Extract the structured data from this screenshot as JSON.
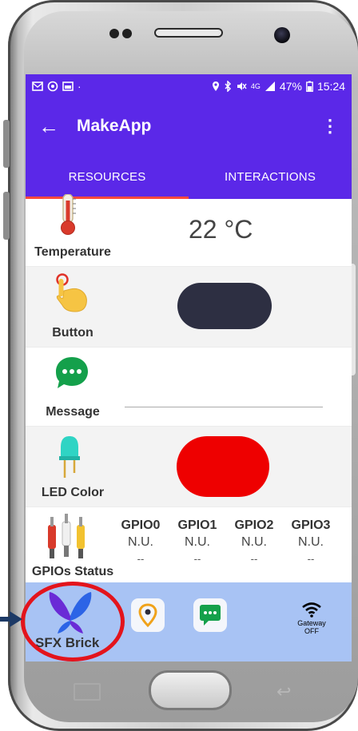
{
  "statusbar": {
    "left_icons": [
      "mail-icon",
      "sync-icon",
      "screenshot-icon"
    ],
    "dot": "·",
    "network": "4G",
    "battery": "47%",
    "time": "15:24"
  },
  "appbar": {
    "back_glyph": "←",
    "title": "MakeApp",
    "more_glyph": "⋮"
  },
  "tabs": [
    {
      "label": "RESOURCES",
      "active": true
    },
    {
      "label": "INTERACTIONS",
      "active": false
    }
  ],
  "resources": {
    "temperature": {
      "label": "Temperature",
      "value": "22 °C"
    },
    "button": {
      "label": "Button",
      "color": "#2d2f42"
    },
    "message": {
      "label": "Message",
      "text": ""
    },
    "led": {
      "label": "LED Color",
      "color": "#ee0000"
    },
    "gpios": {
      "label": "GPIOs Status",
      "columns": [
        {
          "name": "GPIO0",
          "value": "N.U.",
          "extra": "--"
        },
        {
          "name": "GPIO1",
          "value": "N.U.",
          "extra": "--"
        },
        {
          "name": "GPIO2",
          "value": "N.U.",
          "extra": "--"
        },
        {
          "name": "GPIO3",
          "value": "N.U.",
          "extra": "--"
        }
      ]
    }
  },
  "dock": {
    "sfx_label": "SFX Brick",
    "location_icon": "map-pin-icon",
    "chat_icon": "chat-icon",
    "gateway_line1": "Gateway",
    "gateway_line2": "OFF"
  },
  "colors": {
    "primary": "#5b28e8",
    "tab_indicator": "#ff4a3d",
    "dock": "#a8c3f4",
    "annotation": "#e3141c"
  }
}
